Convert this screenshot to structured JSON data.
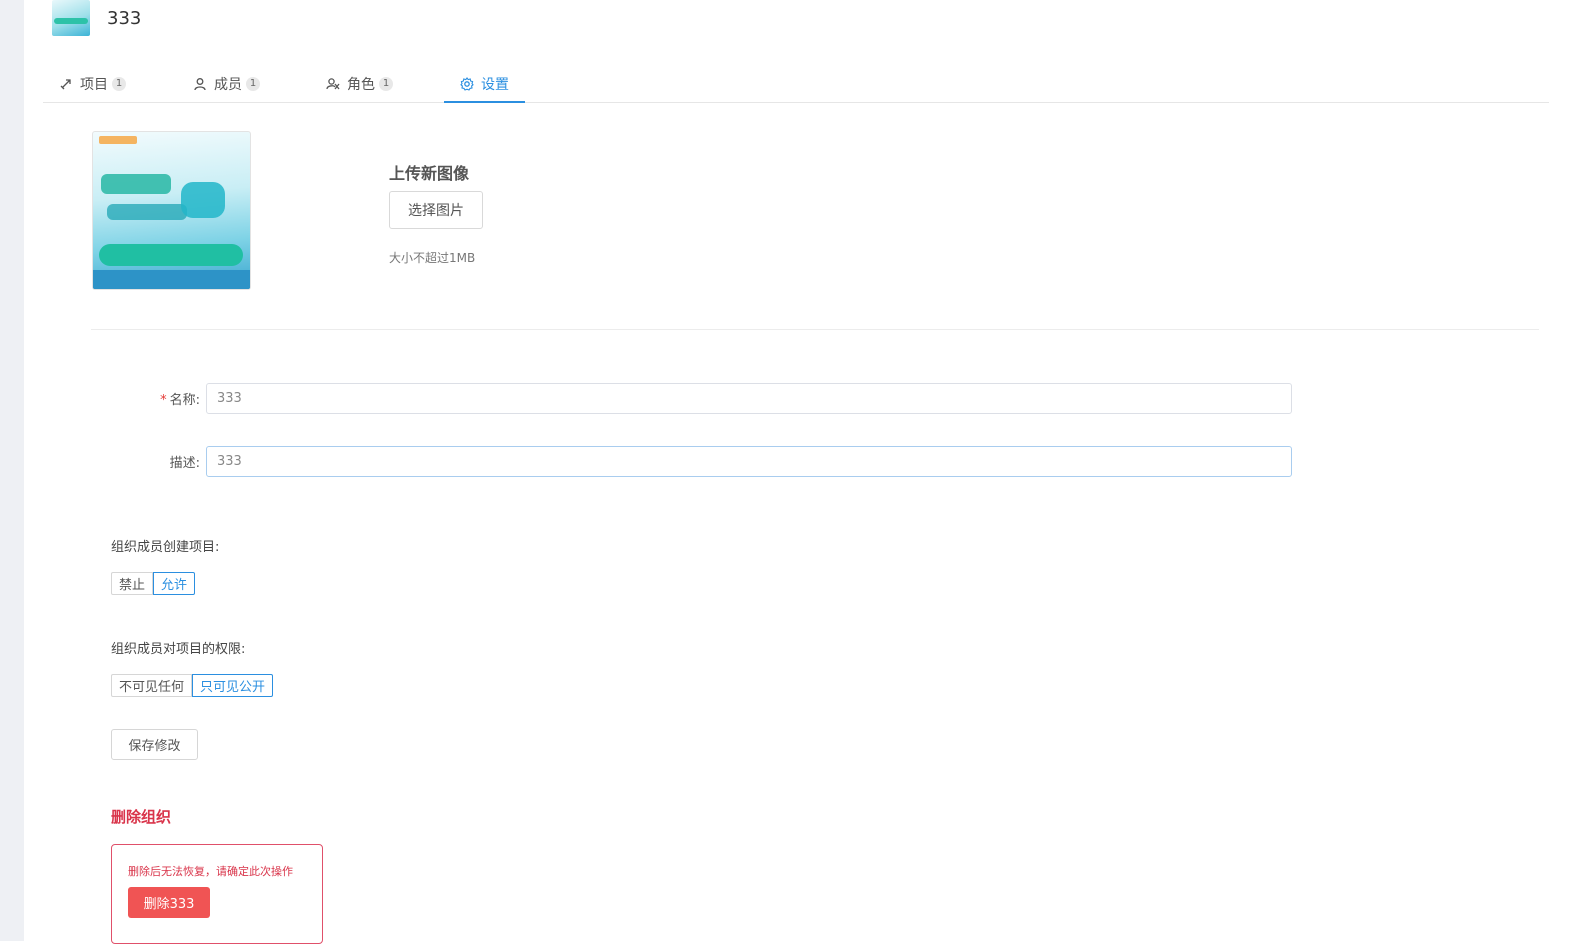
{
  "header": {
    "org_name": "333"
  },
  "tabs": [
    {
      "label": "项目",
      "count": "1",
      "icon": "project-icon"
    },
    {
      "label": "成员",
      "count": "1",
      "icon": "member-icon"
    },
    {
      "label": "角色",
      "count": "1",
      "icon": "role-icon"
    },
    {
      "label": "设置",
      "icon": "gear-icon",
      "active": true
    }
  ],
  "upload": {
    "title": "上传新图像",
    "button_label": "选择图片",
    "hint": "大小不超过1MB"
  },
  "form": {
    "name_required_mark": "*",
    "name_label": "名称:",
    "name_value": "333",
    "desc_label": "描述:",
    "desc_value": "333"
  },
  "create_permission": {
    "label": "组织成员创建项目:",
    "options": [
      "禁止",
      "允许"
    ],
    "selected": "允许"
  },
  "project_permission": {
    "label": "组织成员对项目的权限:",
    "options": [
      "不可见任何",
      "只可见公开"
    ],
    "selected": "只可见公开"
  },
  "save_label": "保存修改",
  "danger": {
    "title": "删除组织",
    "warning": "删除后无法恢复，请确定此次操作",
    "delete_label": "删除333"
  },
  "colors": {
    "accent": "#2b8fe0",
    "danger": "#d9344a",
    "danger_button": "#f05454"
  }
}
